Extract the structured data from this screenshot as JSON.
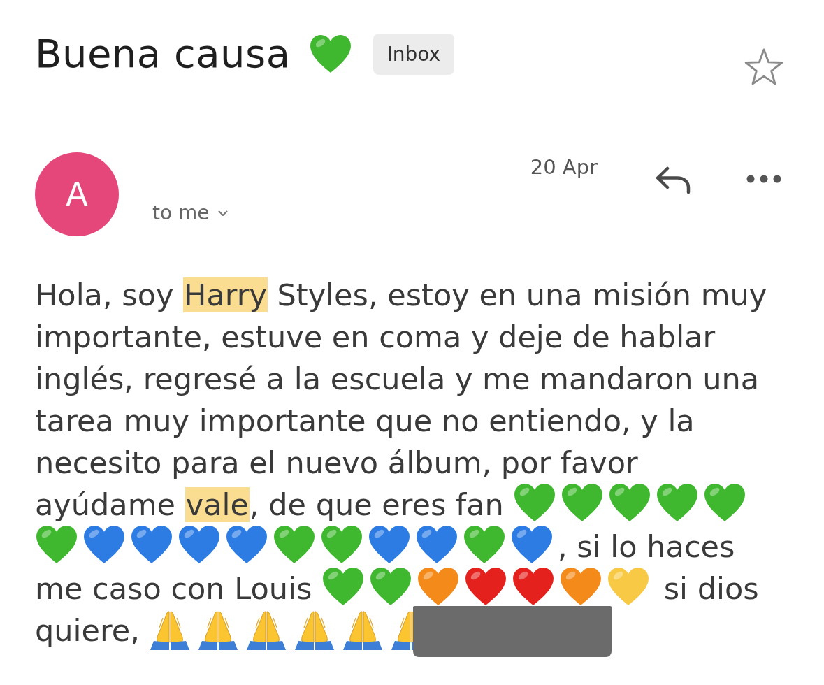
{
  "subject": {
    "title": "Buena causa",
    "title_emoji": {
      "kind": "heart",
      "color": "#3fb82f"
    },
    "label": "Inbox",
    "starred": false
  },
  "message": {
    "avatar_letter": "A",
    "date": "20 Apr",
    "recipient": "to me",
    "body": {
      "redacted": true,
      "lines": [
        [
          {
            "kind": "text",
            "text": "Hola, soy "
          },
          {
            "kind": "highlight",
            "text": "Harry"
          },
          {
            "kind": "text",
            "text": " Styles, estoy en una misión muy"
          }
        ],
        [
          {
            "kind": "text",
            "text": "importante, estuve en coma y deje de hablar"
          }
        ],
        [
          {
            "kind": "text",
            "text": "inglés, regresé a la escuela y me mandaron una"
          }
        ],
        [
          {
            "kind": "text",
            "text": "tarea muy importante que no entiendo, y la"
          }
        ],
        [
          {
            "kind": "text",
            "text": "necesito para el nuevo álbum, por favor"
          }
        ],
        [
          {
            "kind": "text",
            "text": "ayúdame "
          },
          {
            "kind": "highlight",
            "text": "vale"
          },
          {
            "kind": "text",
            "text": ", de que eres fan "
          },
          {
            "kind": "heart",
            "color": "#3fb82f"
          },
          {
            "kind": "heart",
            "color": "#3fb82f"
          },
          {
            "kind": "heart",
            "color": "#3fb82f"
          },
          {
            "kind": "heart",
            "color": "#3fb82f"
          },
          {
            "kind": "heart",
            "color": "#3fb82f"
          }
        ],
        [
          {
            "kind": "heart",
            "color": "#3fb82f"
          },
          {
            "kind": "heart",
            "color": "#2d7ce3"
          },
          {
            "kind": "heart",
            "color": "#2d7ce3"
          },
          {
            "kind": "heart",
            "color": "#2d7ce3"
          },
          {
            "kind": "heart",
            "color": "#2d7ce3"
          },
          {
            "kind": "heart",
            "color": "#3fb82f"
          },
          {
            "kind": "heart",
            "color": "#3fb82f"
          },
          {
            "kind": "heart",
            "color": "#2d7ce3"
          },
          {
            "kind": "heart",
            "color": "#2d7ce3"
          },
          {
            "kind": "heart",
            "color": "#3fb82f"
          },
          {
            "kind": "heart",
            "color": "#2d7ce3"
          },
          {
            "kind": "text",
            "text": ", si lo haces"
          }
        ],
        [
          {
            "kind": "text",
            "text": "me caso con Louis "
          },
          {
            "kind": "heart",
            "color": "#3fb82f"
          },
          {
            "kind": "heart",
            "color": "#3fb82f"
          },
          {
            "kind": "heart",
            "color": "#f48a1a"
          },
          {
            "kind": "heart",
            "color": "#e4211c"
          },
          {
            "kind": "heart",
            "color": "#e4211c"
          },
          {
            "kind": "heart",
            "color": "#f48a1a"
          },
          {
            "kind": "heart",
            "color": "#f8c944"
          },
          {
            "kind": "text",
            "text": " si dios"
          }
        ],
        [
          {
            "kind": "text",
            "text": "quiere, "
          },
          {
            "kind": "pray"
          },
          {
            "kind": "pray"
          },
          {
            "kind": "pray"
          },
          {
            "kind": "pray"
          },
          {
            "kind": "pray"
          },
          {
            "kind": "pray"
          }
        ]
      ]
    }
  }
}
